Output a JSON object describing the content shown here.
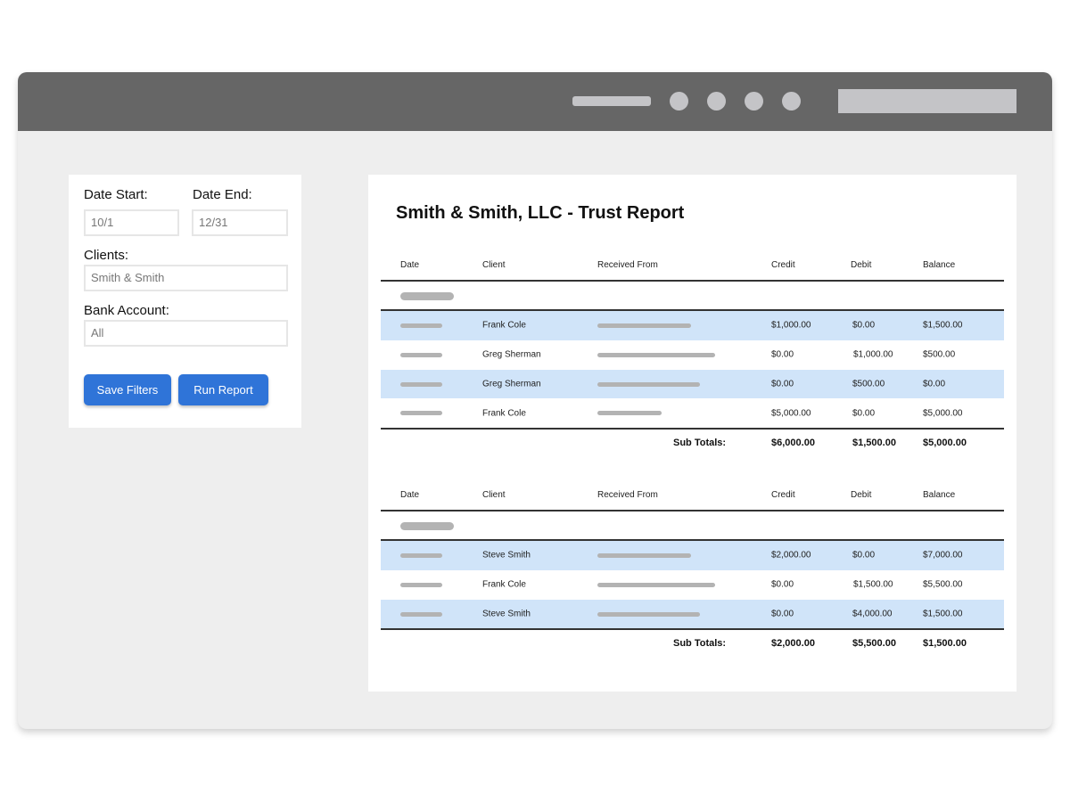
{
  "filters": {
    "date_start_label": "Date Start:",
    "date_start_value": "10/1",
    "date_end_label": "Date End:",
    "date_end_value": "12/31",
    "clients_label": "Clients:",
    "clients_value": "Smith & Smith",
    "bank_account_label": "Bank Account:",
    "bank_account_value": "All",
    "save_filters_label": "Save Filters",
    "run_report_label": "Run Report"
  },
  "report": {
    "title": "Smith & Smith, LLC - Trust Report",
    "columns": [
      "Date",
      "Client",
      "Received From",
      "Credit",
      "Debit",
      "Balance"
    ],
    "subtotals_label": "Sub Totals:",
    "tables": [
      {
        "rows": [
          {
            "client": "Frank Cole",
            "credit": "$1,000.00",
            "debit": "$0.00",
            "balance": "$1,500.00"
          },
          {
            "client": "Greg Sherman",
            "credit": "$0.00",
            "debit": "$1,000.00",
            "balance": "$500.00"
          },
          {
            "client": "Greg Sherman",
            "credit": "$0.00",
            "debit": "$500.00",
            "balance": "$0.00"
          },
          {
            "client": "Frank Cole",
            "credit": "$5,000.00",
            "debit": "$0.00",
            "balance": "$5,000.00"
          }
        ],
        "subtotals": {
          "credit": "$6,000.00",
          "debit": "$1,500.00",
          "balance": "$5,000.00"
        }
      },
      {
        "rows": [
          {
            "client": "Steve Smith",
            "credit": "$2,000.00",
            "debit": "$0.00",
            "balance": "$7,000.00"
          },
          {
            "client": "Frank Cole",
            "credit": "$0.00",
            "debit": "$1,500.00",
            "balance": "$5,500.00"
          },
          {
            "client": "Steve Smith",
            "credit": "$0.00",
            "debit": "$4,000.00",
            "balance": "$1,500.00"
          }
        ],
        "subtotals": {
          "credit": "$2,000.00",
          "debit": "$5,500.00",
          "balance": "$1,500.00"
        }
      }
    ]
  }
}
